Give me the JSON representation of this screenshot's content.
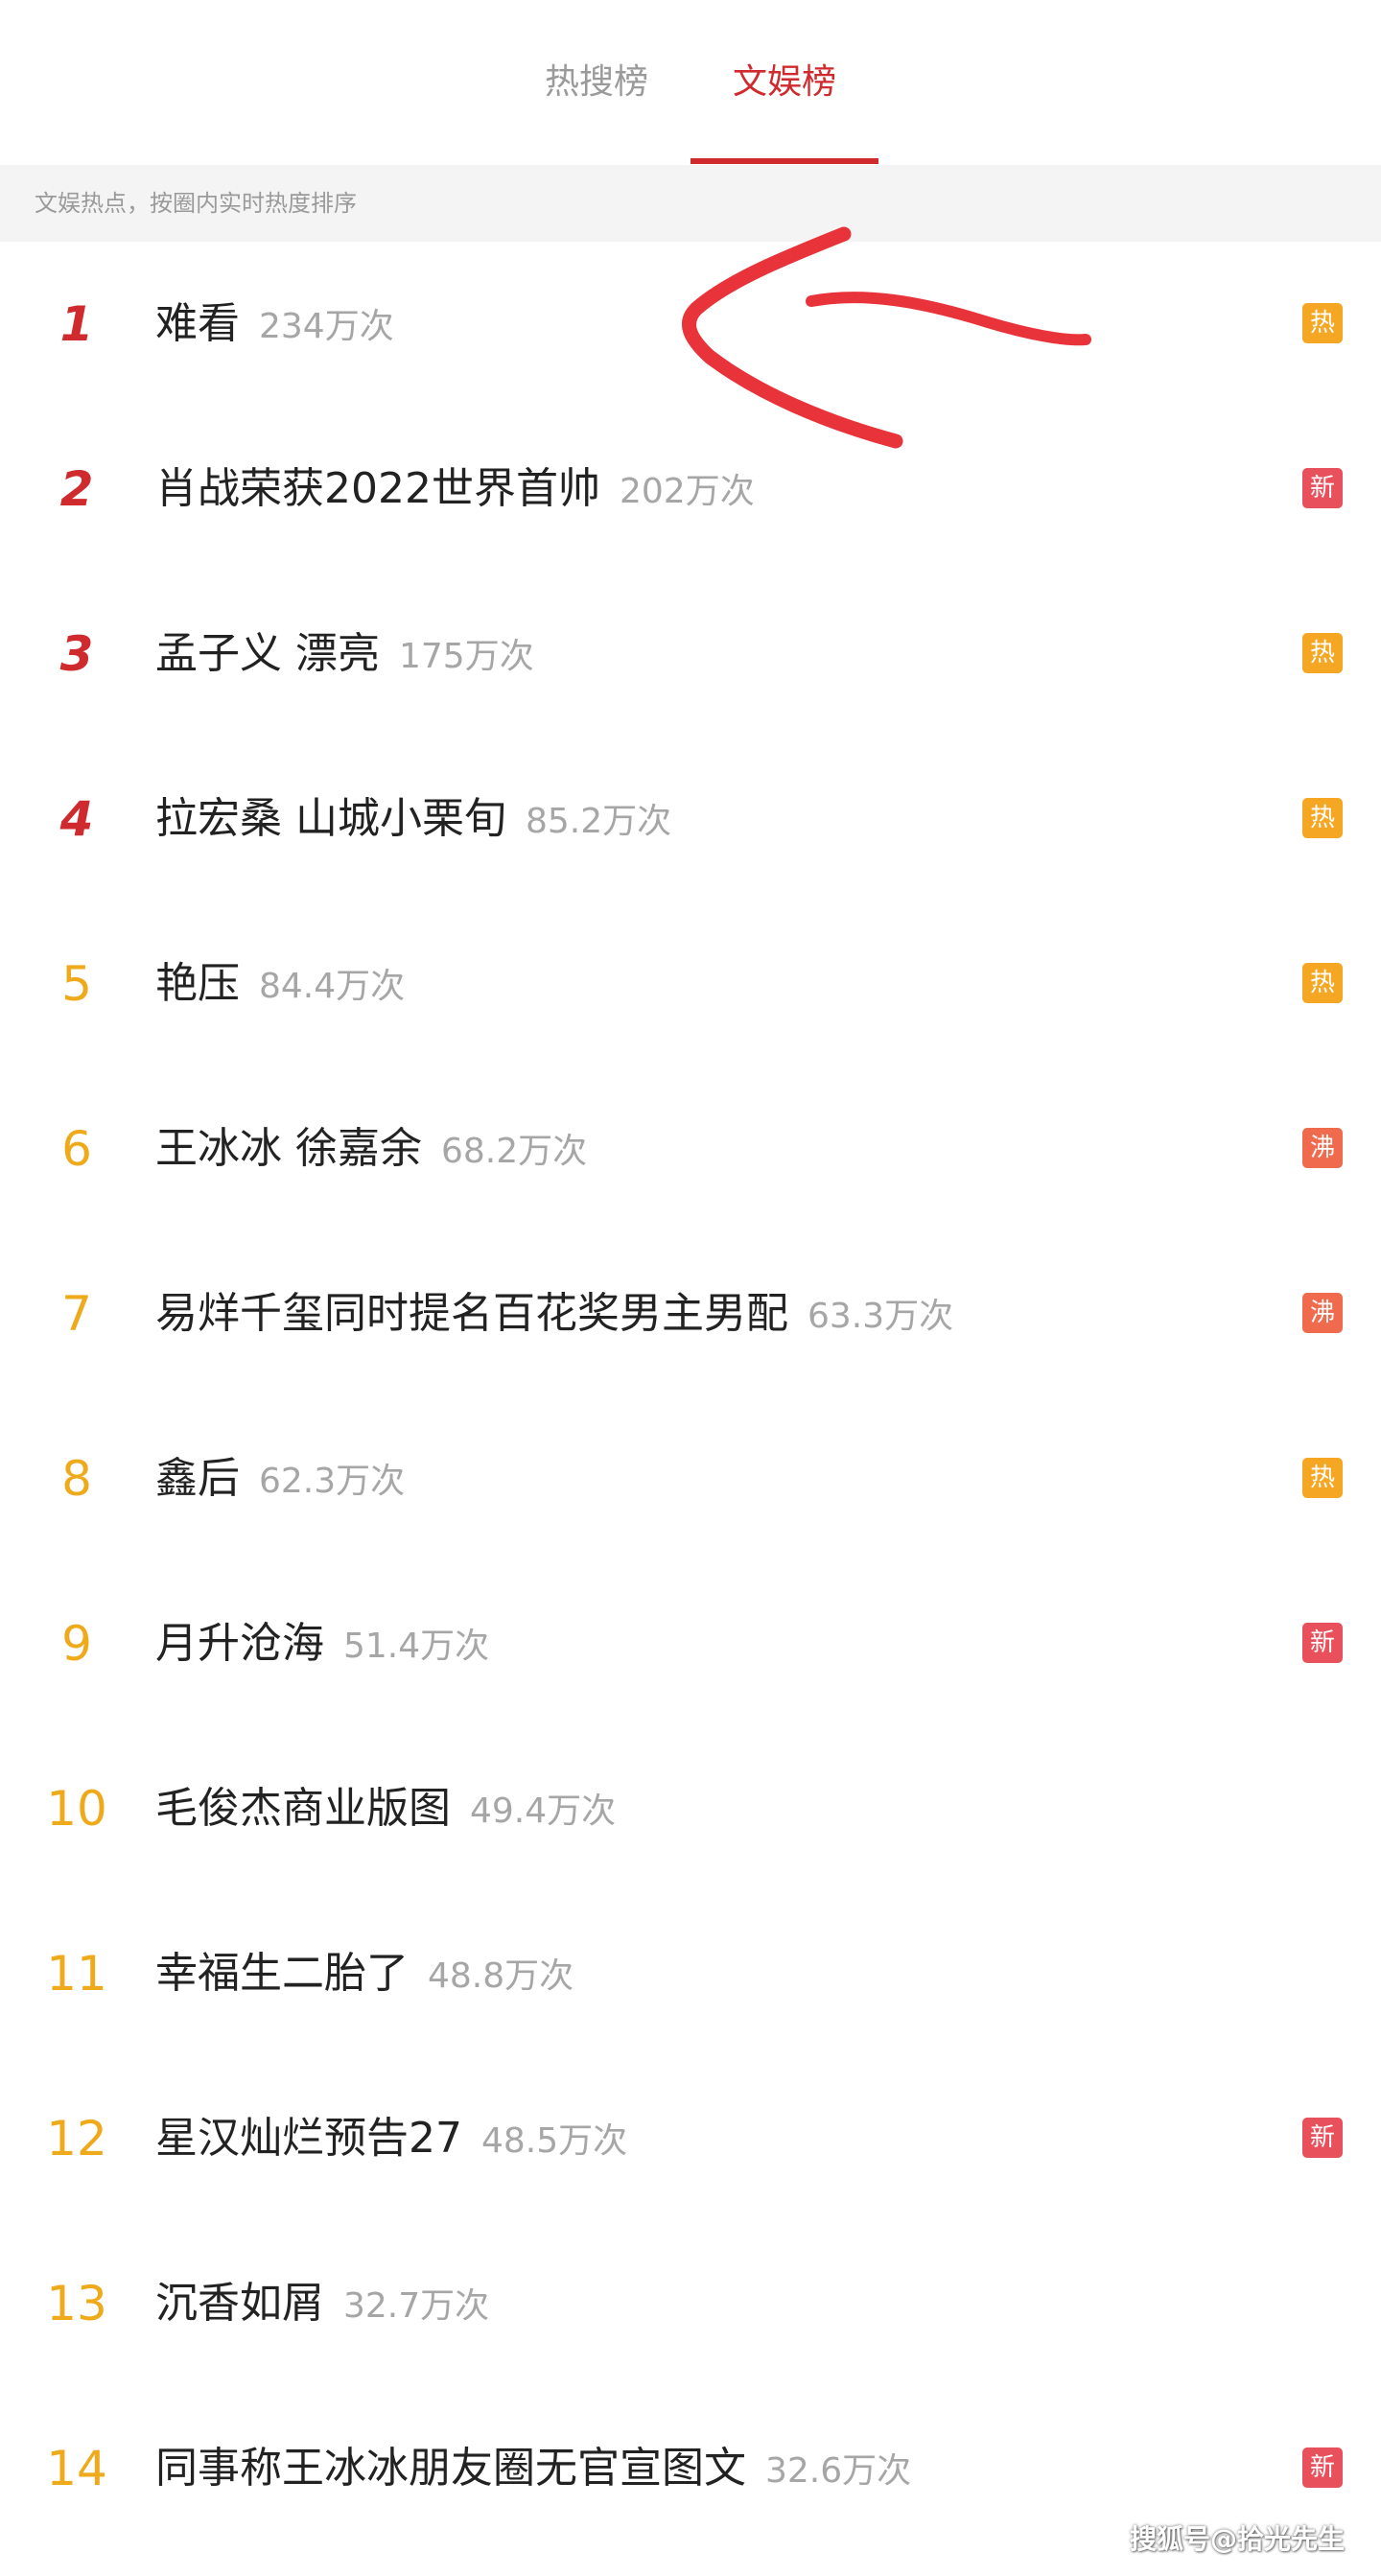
{
  "tabs": [
    {
      "label": "热搜榜",
      "active": false
    },
    {
      "label": "文娱榜",
      "active": true
    }
  ],
  "subtitle": "文娱热点，按圈内实时热度排序",
  "badge_colors": {
    "热": "#f5a623",
    "新": "#e8505b",
    "沸": "#f06a4e"
  },
  "rank_colors": {
    "top": "#cf2b2f",
    "normal": "#eeaa1b"
  },
  "items": [
    {
      "rank": "1",
      "title": "难看",
      "count": "234万次",
      "badge": "热"
    },
    {
      "rank": "2",
      "title": "肖战荣获2022世界首帅",
      "count": "202万次",
      "badge": "新"
    },
    {
      "rank": "3",
      "title": "孟子义 漂亮",
      "count": "175万次",
      "badge": "热"
    },
    {
      "rank": "4",
      "title": "拉宏桑 山城小栗旬",
      "count": "85.2万次",
      "badge": "热"
    },
    {
      "rank": "5",
      "title": "艳压",
      "count": "84.4万次",
      "badge": "热"
    },
    {
      "rank": "6",
      "title": "王冰冰 徐嘉余",
      "count": "68.2万次",
      "badge": "沸"
    },
    {
      "rank": "7",
      "title": "易烊千玺同时提名百花奖男主男配",
      "count": "63.3万次",
      "badge": "沸"
    },
    {
      "rank": "8",
      "title": "鑫后",
      "count": "62.3万次",
      "badge": "热"
    },
    {
      "rank": "9",
      "title": "月升沧海",
      "count": "51.4万次",
      "badge": "新"
    },
    {
      "rank": "10",
      "title": "毛俊杰商业版图",
      "count": "49.4万次",
      "badge": ""
    },
    {
      "rank": "11",
      "title": "幸福生二胎了",
      "count": "48.8万次",
      "badge": ""
    },
    {
      "rank": "12",
      "title": "星汉灿烂预告27",
      "count": "48.5万次",
      "badge": "新"
    },
    {
      "rank": "13",
      "title": "沉香如屑",
      "count": "32.7万次",
      "badge": ""
    },
    {
      "rank": "14",
      "title": "同事称王冰冰朋友圈无官宣图文",
      "count": "32.6万次",
      "badge": "新"
    }
  ],
  "watermark": "搜狐号@拾光先生",
  "annotation_color": "#e8333b"
}
